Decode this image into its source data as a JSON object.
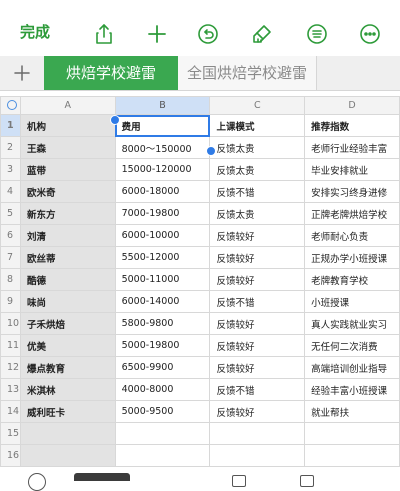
{
  "toolbar": {
    "done_label": "完成",
    "icons": [
      "share-icon",
      "add-icon",
      "undo-icon",
      "brush-icon",
      "format-icon",
      "more-icon"
    ],
    "accent": "#2e9b3a"
  },
  "tabs": [
    {
      "label": "烘焙学校避雷",
      "active": true
    },
    {
      "label": "全国烘焙学校避雷",
      "active": false
    }
  ],
  "columns": [
    "A",
    "B",
    "C",
    "D"
  ],
  "rows": [
    {
      "num": "1",
      "cells": [
        "机构",
        "费用",
        "上课模式",
        "推荐指数"
      ]
    },
    {
      "num": "2",
      "cells": [
        "王森",
        "8000～150000",
        "反馈太贵",
        "老师行业经验丰富"
      ]
    },
    {
      "num": "3",
      "cells": [
        "蓝带",
        "15000-120000",
        "反馈太贵",
        "毕业安排就业"
      ]
    },
    {
      "num": "4",
      "cells": [
        "欧米奇",
        "6000-18000",
        "反馈不错",
        "安排实习终身进修"
      ]
    },
    {
      "num": "5",
      "cells": [
        "新东方",
        "7000-19800",
        "反馈太贵",
        "正牌老牌烘焙学校"
      ]
    },
    {
      "num": "6",
      "cells": [
        "刘清",
        "6000-10000",
        "反馈较好",
        "老师耐心负责"
      ]
    },
    {
      "num": "7",
      "cells": [
        "欧丝蒂",
        "5500-12000",
        "反馈较好",
        "正规办学小班授课"
      ]
    },
    {
      "num": "8",
      "cells": [
        "酷德",
        "5000-11000",
        "反馈较好",
        "老牌教育学校"
      ]
    },
    {
      "num": "9",
      "cells": [
        "味尚",
        "6000-14000",
        "反馈不错",
        "小班授课"
      ]
    },
    {
      "num": "10",
      "cells": [
        "子禾烘焙",
        "5800-9800",
        "反馈较好",
        "真人实践就业实习"
      ]
    },
    {
      "num": "11",
      "cells": [
        "优美",
        "5000-19800",
        "反馈较好",
        "无任何二次消费"
      ]
    },
    {
      "num": "12",
      "cells": [
        "爆点教育",
        "6500-9900",
        "反馈较好",
        "高端培训创业指导"
      ]
    },
    {
      "num": "13",
      "cells": [
        "米淇林",
        "4000-8000",
        "反馈不错",
        "经验丰富小班授课"
      ]
    },
    {
      "num": "14",
      "cells": [
        "威利旺卡",
        "5000-9500",
        "反馈较好",
        "就业帮扶"
      ]
    },
    {
      "num": "15",
      "cells": [
        "",
        "",
        "",
        ""
      ]
    },
    {
      "num": "16",
      "cells": [
        "",
        "",
        "",
        ""
      ]
    }
  ],
  "selection": {
    "cell": "B1"
  }
}
